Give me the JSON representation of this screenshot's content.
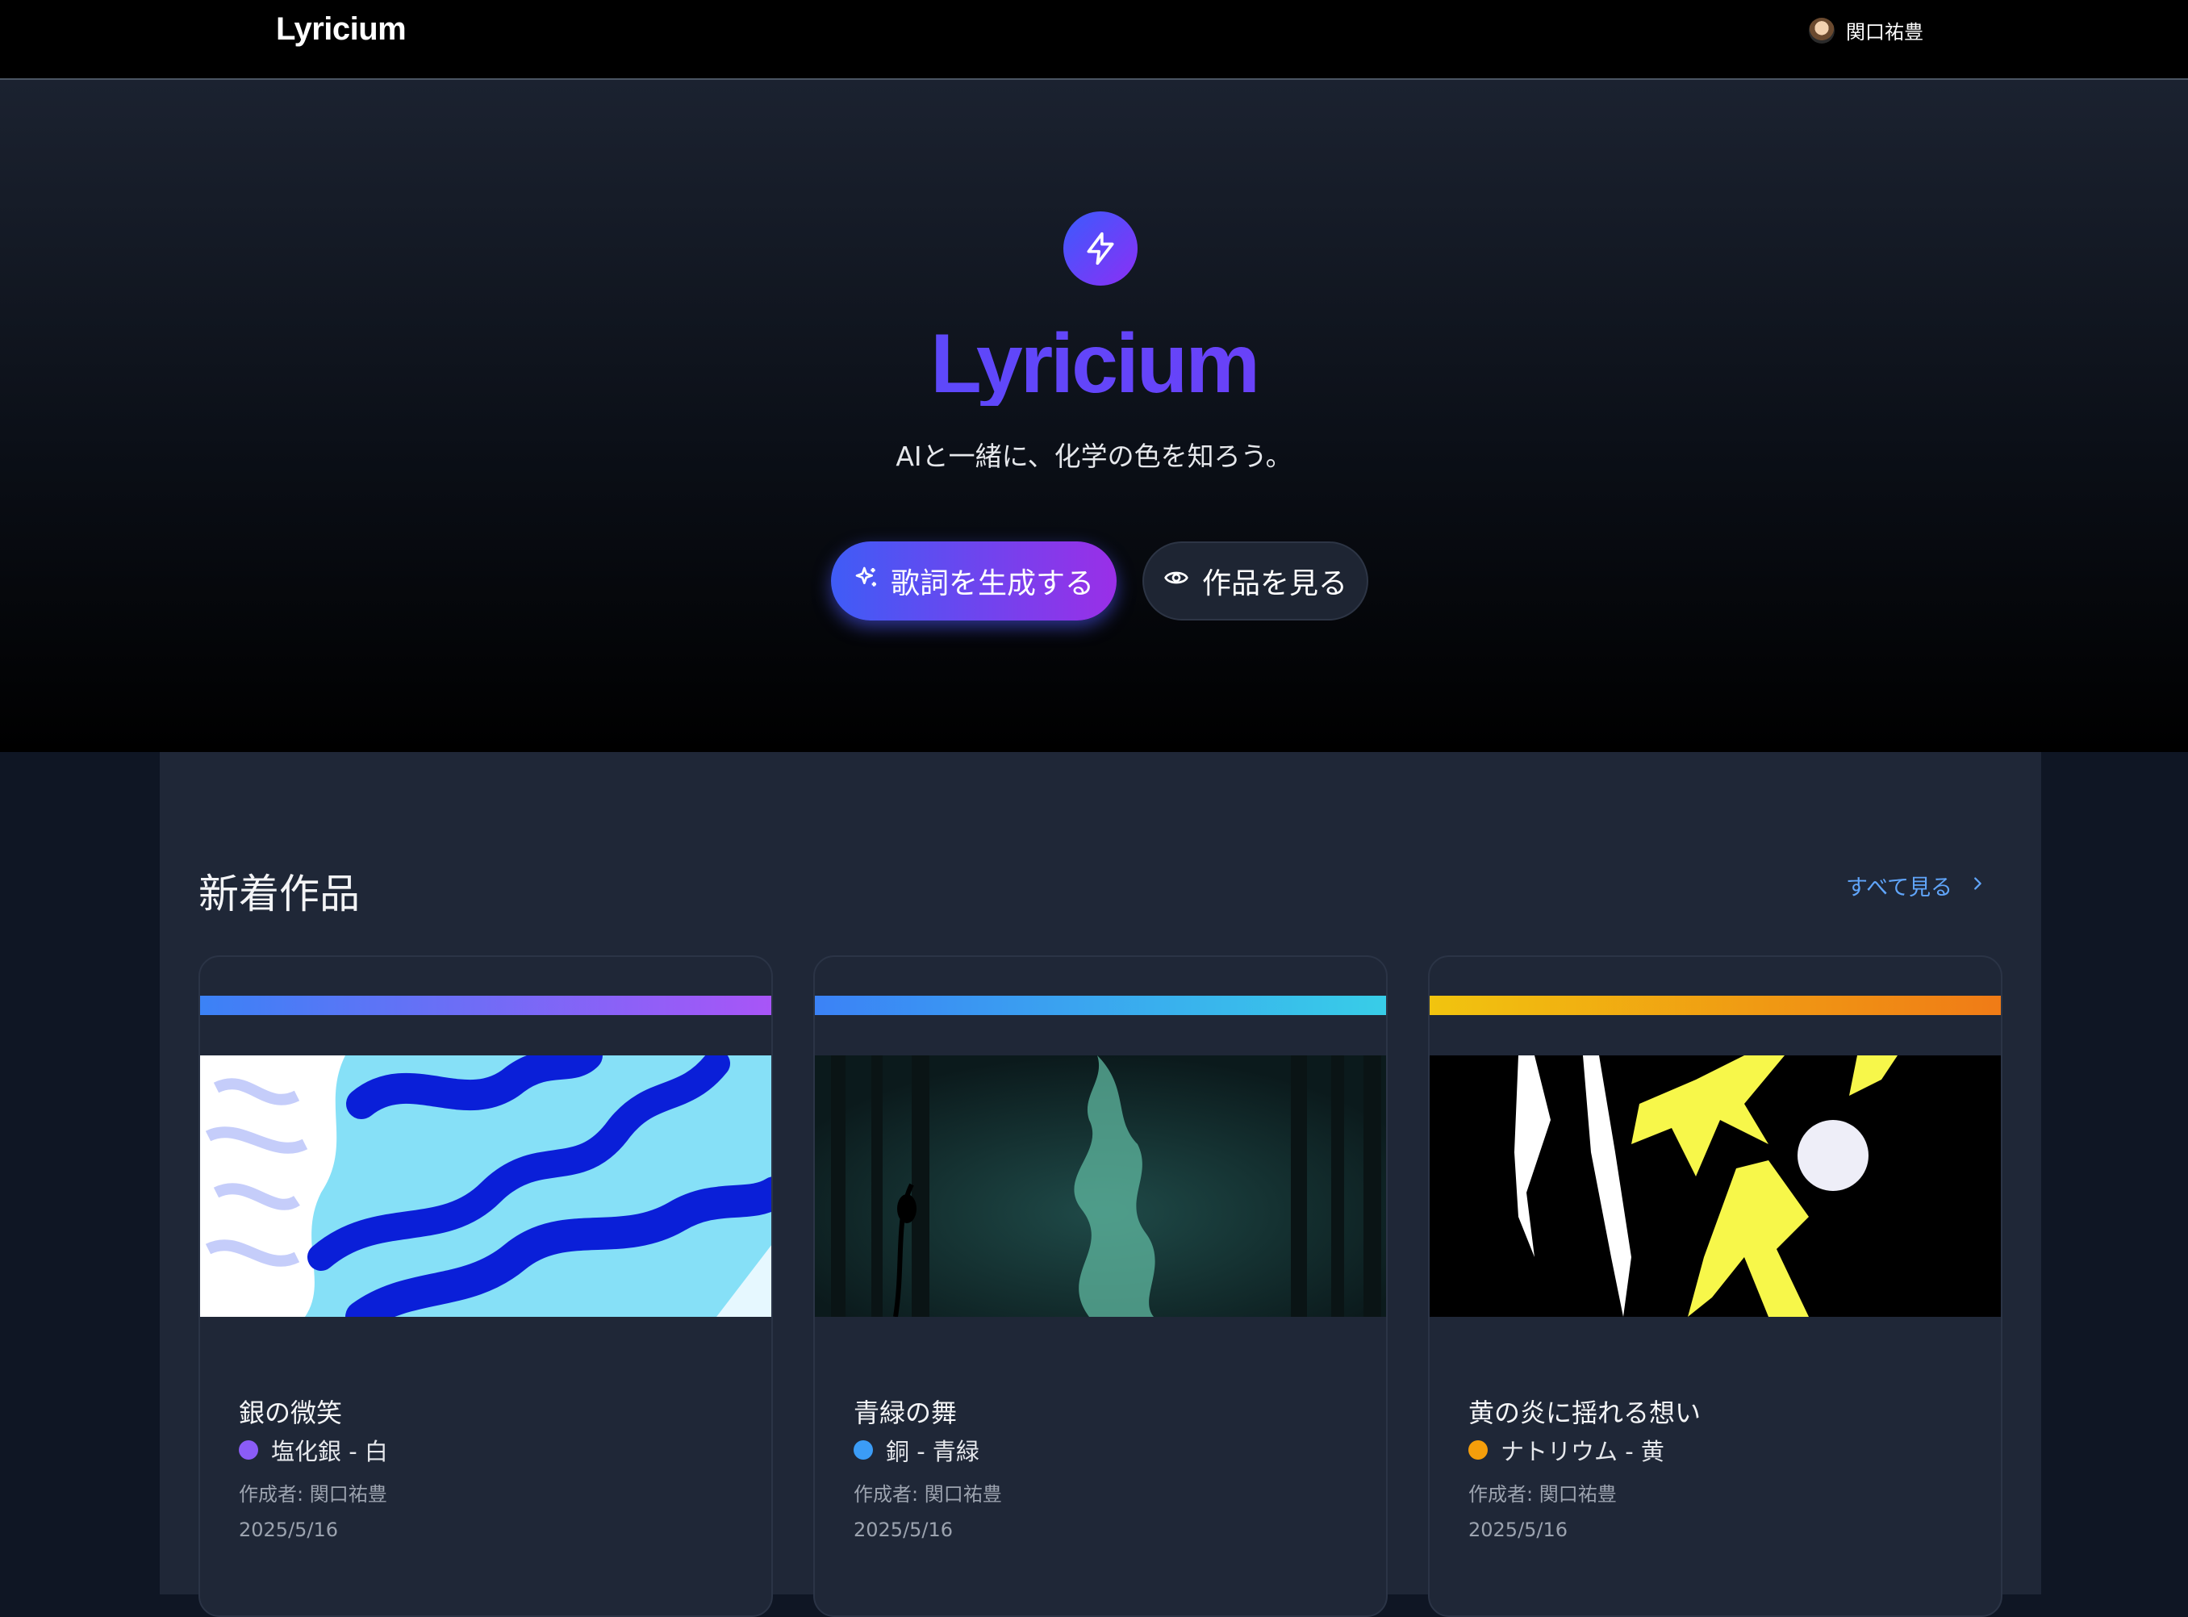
{
  "nav": {
    "brand": "Lyricium",
    "user_name": "関口祐豊",
    "avatar_icon": "user-avatar"
  },
  "hero": {
    "icon": "lightning-icon",
    "title": "Lyricium",
    "subtitle": "AIと一緒に、化学の色を知ろう。",
    "primary_button": {
      "label": "歌詞を生成する",
      "icon": "sparkles-icon"
    },
    "secondary_button": {
      "label": "作品を見る",
      "icon": "eye-icon"
    },
    "accent_from": "#3b5bfd",
    "accent_to": "#8b2ff5"
  },
  "recent": {
    "title": "新着作品",
    "see_all": "すべて見る",
    "cards": [
      {
        "title": "銀の微笑",
        "element": "塩化銀 - 白",
        "dot_color": "#8b5cf6",
        "bar_from": "#3b82f6",
        "bar_to": "#a855f7",
        "author": "作成者: 関口祐豊",
        "date": "2025/5/16"
      },
      {
        "title": "青緑の舞",
        "element": "銅 - 青緑",
        "dot_color": "#3b9cf6",
        "bar_from": "#3b82f6",
        "bar_to": "#38cde8",
        "author": "作成者: 関口祐豊",
        "date": "2025/5/16"
      },
      {
        "title": "黄の炎に揺れる想い",
        "element": "ナトリウム - 黄",
        "dot_color": "#f59e0b",
        "bar_from": "#f1c40f",
        "bar_to": "#f07b16",
        "author": "作成者: 関口祐豊",
        "date": "2025/5/16"
      }
    ]
  }
}
